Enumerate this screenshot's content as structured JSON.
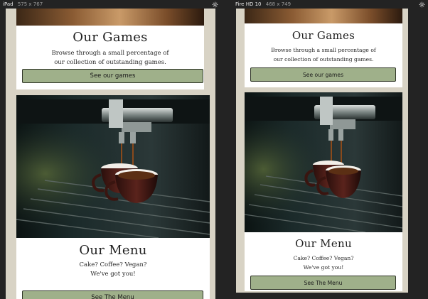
{
  "devices": [
    {
      "name": "iPad",
      "size": "575 x 767"
    },
    {
      "name": "Fire HD 10",
      "size": "468 x 749"
    }
  ],
  "games": {
    "title": "Our Games",
    "description_line1": "Browse through a small percentage of",
    "description_line2": "our collection of outstanding games.",
    "button_label": "See our games"
  },
  "menu": {
    "title": "Our Menu",
    "description_line1": "Cake? Coffee? Vegan?",
    "description_line2": "We've got you!",
    "button_label": "See The Menu"
  },
  "icons": {
    "settings": "gear-icon"
  },
  "colors": {
    "page_background": "#d8d3c5",
    "card_background": "#ffffff",
    "button_background": "#9fb08a",
    "button_border": "#2e3426",
    "devtools_background": "#232323"
  }
}
